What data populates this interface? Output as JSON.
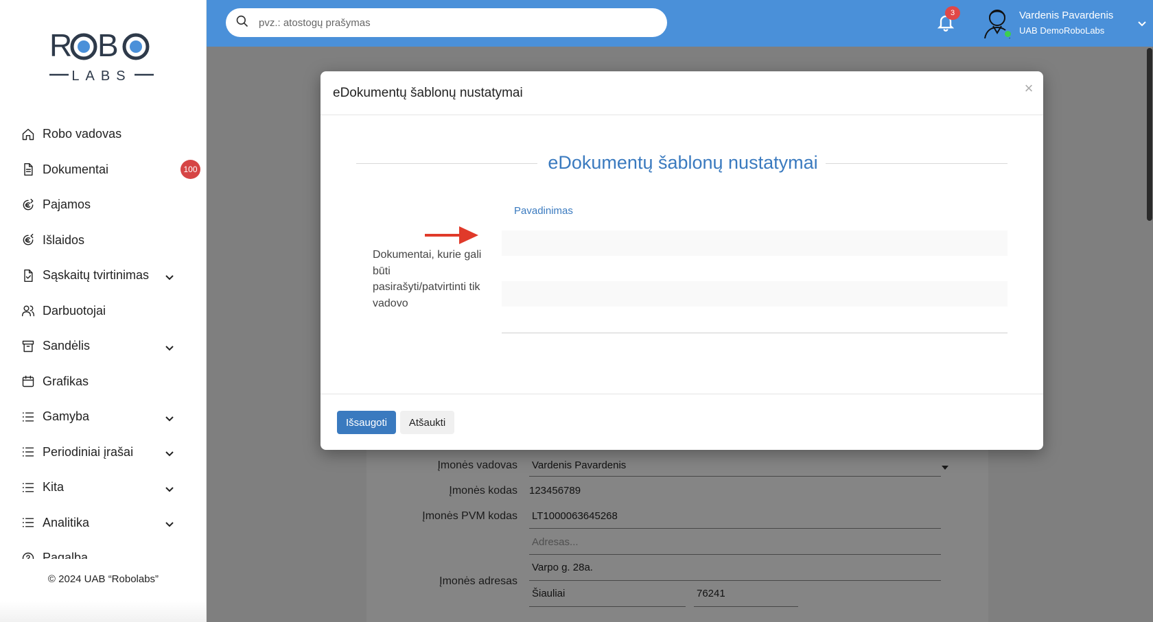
{
  "app": {
    "logo_text": "ROBO",
    "logo_subtext": "LABS"
  },
  "sidebar": {
    "items": [
      {
        "label": "Robo vadovas",
        "icon": "home-icon"
      },
      {
        "label": "Dokumentai",
        "icon": "document-icon",
        "badge": "100"
      },
      {
        "label": "Pajamos",
        "icon": "euro-income-icon"
      },
      {
        "label": "Išlaidos",
        "icon": "euro-expense-icon"
      },
      {
        "label": "Sąskaitų tvirtinimas",
        "icon": "file-check-icon",
        "expandable": true
      },
      {
        "label": "Darbuotojai",
        "icon": "users-icon"
      },
      {
        "label": "Sandėlis",
        "icon": "archive-icon",
        "expandable": true
      },
      {
        "label": "Grafikas",
        "icon": "calendar-icon"
      },
      {
        "label": "Gamyba",
        "icon": "list-icon",
        "expandable": true
      },
      {
        "label": "Periodiniai įrašai",
        "icon": "list-icon",
        "expandable": true
      },
      {
        "label": "Kita",
        "icon": "list-icon",
        "expandable": true
      },
      {
        "label": "Analitika",
        "icon": "list-icon",
        "expandable": true
      },
      {
        "label": "Pagalba",
        "icon": "help-icon"
      }
    ],
    "copyright": "© 2024 UAB “Robolabs”"
  },
  "header": {
    "search_placeholder": "pvz.: atostogų prašymas",
    "notifications_count": "3",
    "user_name": "Vardenis Pavardenis",
    "user_company": "UAB DemoRoboLabs",
    "accent_color": "#4a90d9"
  },
  "background_form": {
    "fields": {
      "manager_label": "Įmonės vadovas",
      "manager_value": "Vardenis Pavardenis",
      "code_label": "Įmonės kodas",
      "code_value": "123456789",
      "vat_label": "Įmonės PVM kodas",
      "vat_value": "LT1000063645268",
      "address_label": "Įmonės adresas",
      "address_placeholder": "Adresas...",
      "street_value": "Varpo g. 28a.",
      "city_value": "Šiauliai",
      "postcode_value": "76241"
    }
  },
  "modal": {
    "title": "eDokumentų šablonų nustatymai",
    "close_symbol": "×",
    "section_title": "eDokumentų šablonų nustatymai",
    "column_header": "Pavadinimas",
    "row_label": "Dokumentai, kurie gali būti pasirašyti/patvirtinti tik vadovo",
    "save_label": "Išsaugoti",
    "cancel_label": "Atšaukti",
    "annotation_arrow_color": "#e03a2a"
  }
}
